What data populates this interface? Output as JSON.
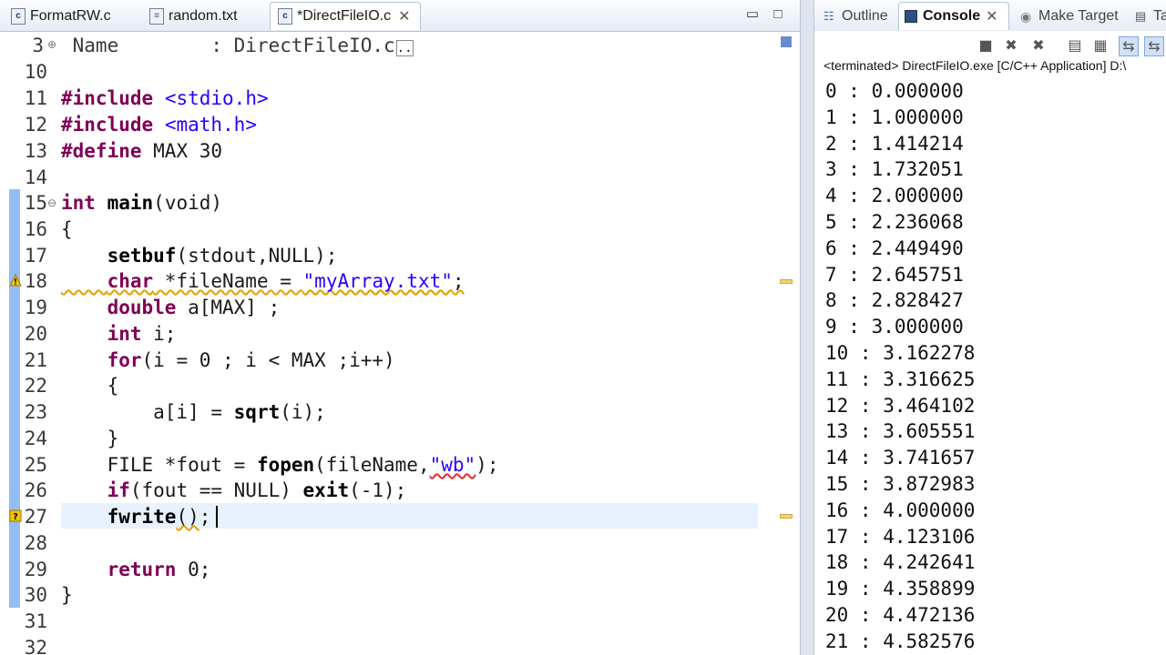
{
  "editor": {
    "tabs": [
      {
        "label": "FormatRW.c",
        "icon": "c-file-icon"
      },
      {
        "label": "random.txt",
        "icon": "text-file-icon"
      },
      {
        "label": "*DirectFileIO.c",
        "icon": "c-file-icon",
        "close": "✕"
      }
    ],
    "lines": [
      {
        "num": "3",
        "text": " Name        : DirectFileIO.c"
      },
      {
        "num": "10",
        "text": ""
      },
      {
        "num": "11",
        "text": "#include <stdio.h>"
      },
      {
        "num": "12",
        "text": "#include <math.h>"
      },
      {
        "num": "13",
        "text": "#define MAX 30"
      },
      {
        "num": "14",
        "text": ""
      },
      {
        "num": "15",
        "text": "int main(void)"
      },
      {
        "num": "16",
        "text": "{"
      },
      {
        "num": "17",
        "text": "    setbuf(stdout,NULL);"
      },
      {
        "num": "18",
        "text": "    char *fileName = \"myArray.txt\";"
      },
      {
        "num": "19",
        "text": "    double a[MAX] ;"
      },
      {
        "num": "20",
        "text": "    int i;"
      },
      {
        "num": "21",
        "text": "    for(i = 0 ; i < MAX ;i++)"
      },
      {
        "num": "22",
        "text": "    {"
      },
      {
        "num": "23",
        "text": "        a[i] = sqrt(i);"
      },
      {
        "num": "24",
        "text": "    }"
      },
      {
        "num": "25",
        "text": "    FILE *fout = fopen(fileName,\"wb\");"
      },
      {
        "num": "26",
        "text": "    if(fout == NULL) exit(-1);"
      },
      {
        "num": "27",
        "text": "    fwrite();"
      },
      {
        "num": "28",
        "text": ""
      },
      {
        "num": "29",
        "text": "    return 0;"
      },
      {
        "num": "30",
        "text": "}"
      },
      {
        "num": "31",
        "text": ""
      },
      {
        "num": "32",
        "text": ""
      }
    ]
  },
  "console": {
    "tabs": [
      {
        "label": "Outline"
      },
      {
        "label": "Console",
        "close": "✕"
      },
      {
        "label": "Make Target"
      },
      {
        "label": "Ta"
      }
    ],
    "status": "<terminated> DirectFileIO.exe [C/C++ Application] D:\\",
    "output": [
      "0 : 0.000000",
      "1 : 1.000000",
      "2 : 1.414214",
      "3 : 1.732051",
      "4 : 2.000000",
      "5 : 2.236068",
      "6 : 2.449490",
      "7 : 2.645751",
      "8 : 2.828427",
      "9 : 3.000000",
      "10 : 3.162278",
      "11 : 3.316625",
      "12 : 3.464102",
      "13 : 3.605551",
      "14 : 3.741657",
      "15 : 3.872983",
      "16 : 4.000000",
      "17 : 4.123106",
      "18 : 4.242641",
      "19 : 4.358899",
      "20 : 4.472136",
      "21 : 4.582576"
    ]
  },
  "colors": {
    "keyword": "#7f0055",
    "string": "#2a00ff",
    "current_line": "#e8f2fe",
    "change_bar": "#6fa8f0"
  }
}
